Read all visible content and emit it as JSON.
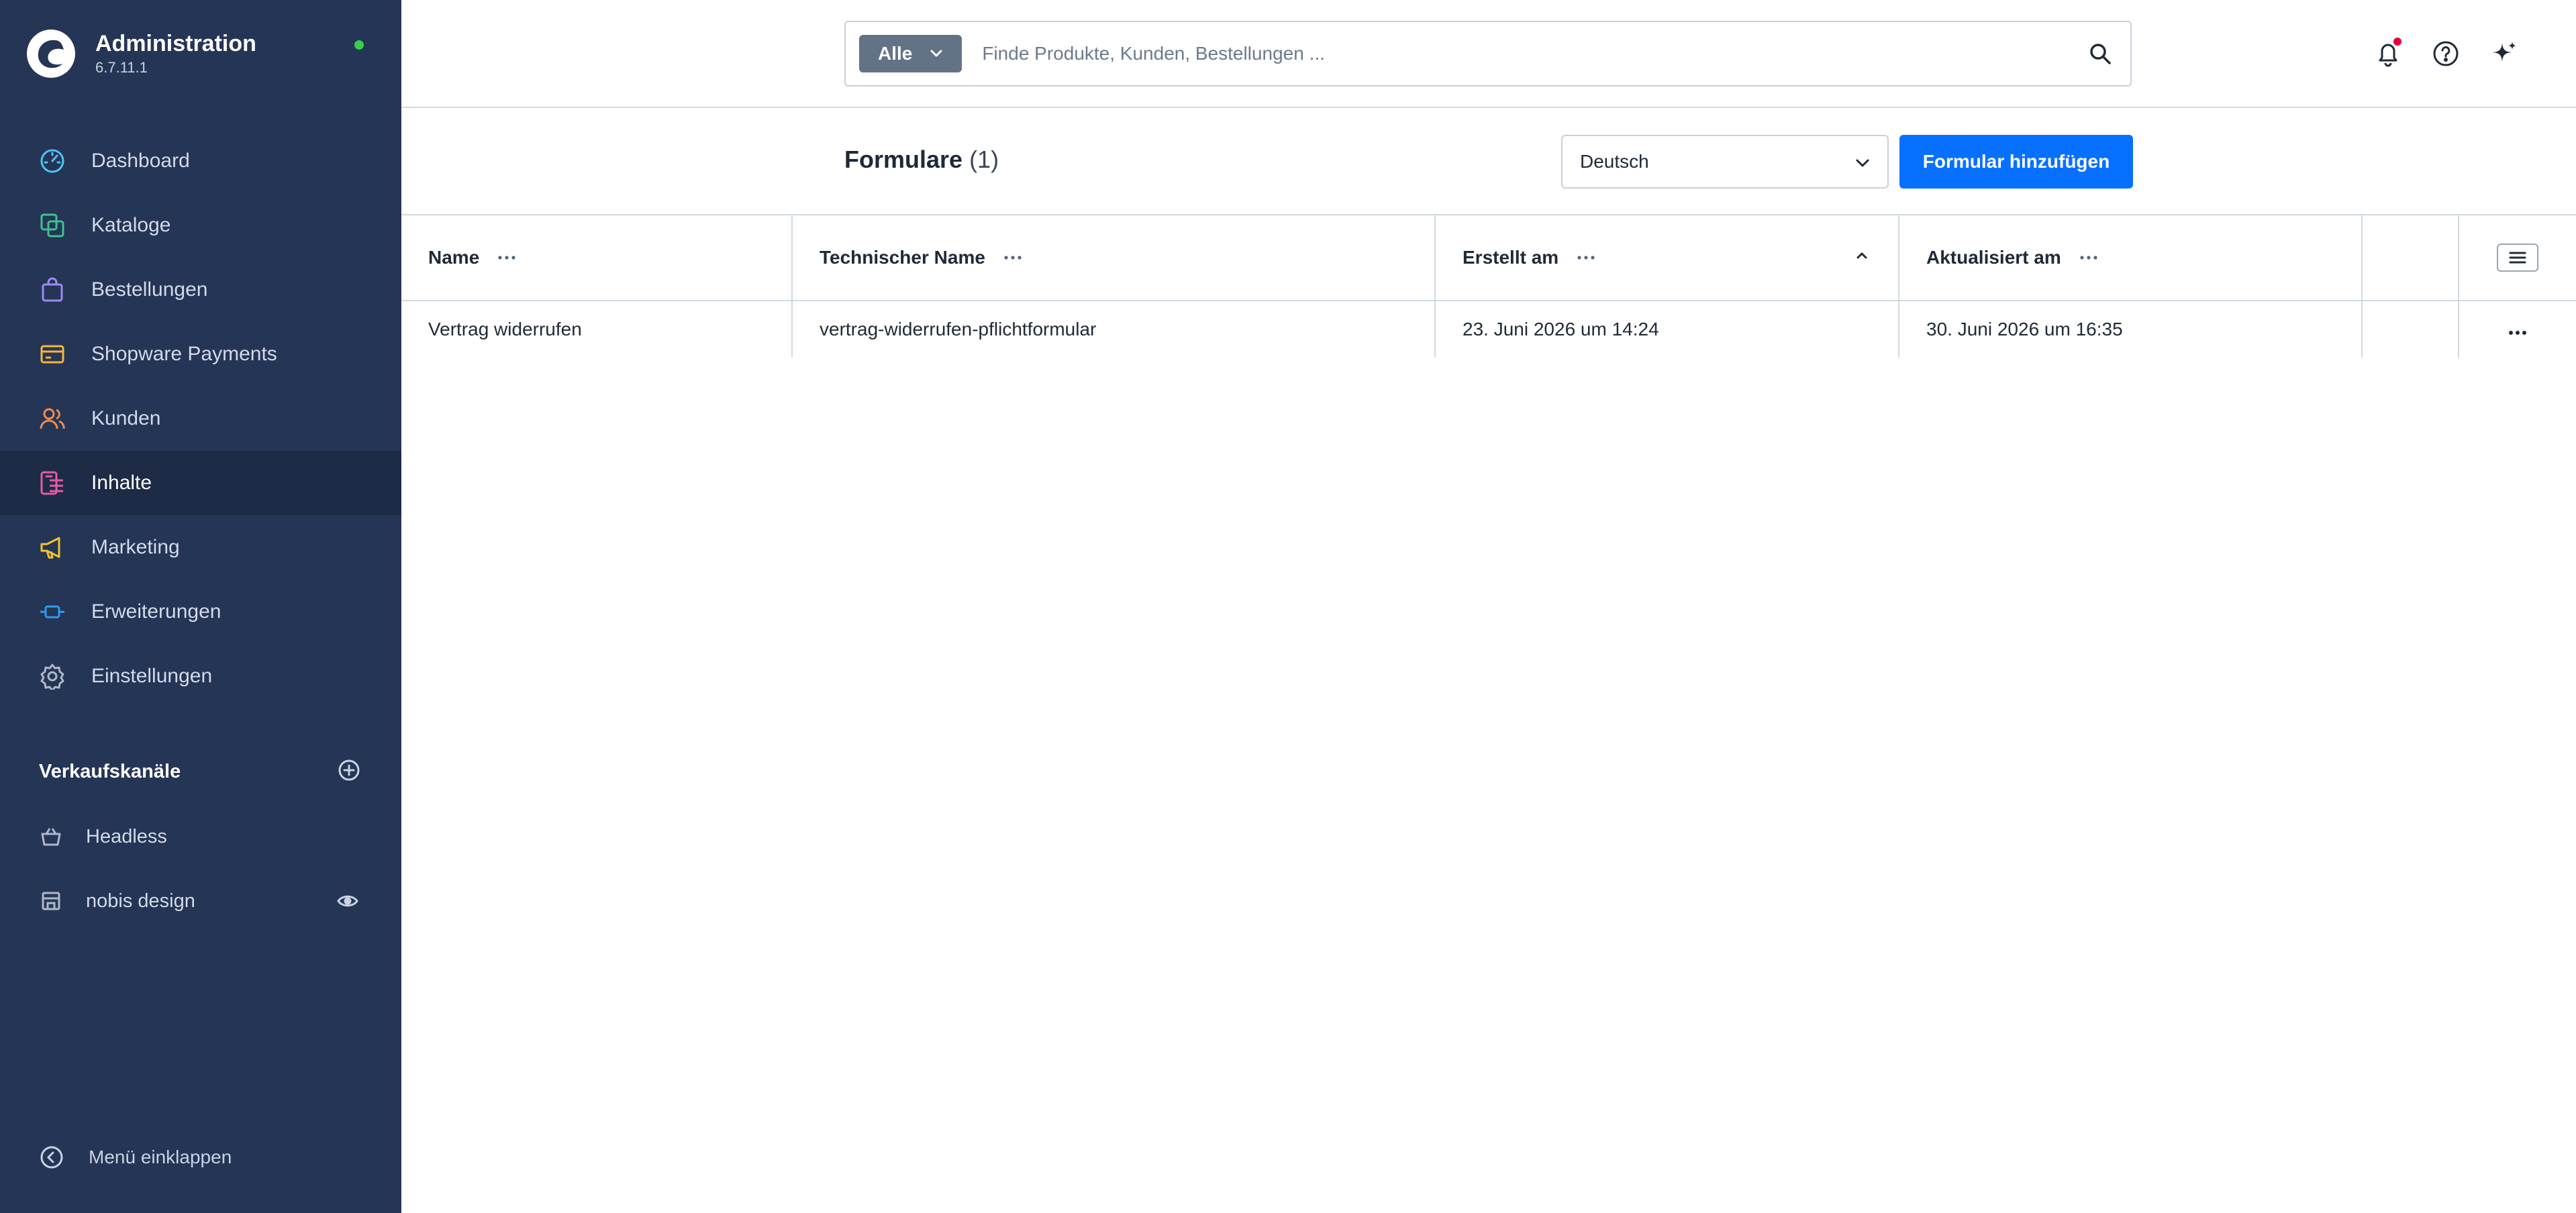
{
  "app": {
    "title": "Administration",
    "version": "6.7.11.1"
  },
  "colors": {
    "sidebar_bg": "#253556",
    "sidebar_active": "#1d2b46",
    "primary": "#0870ff",
    "status_online": "#37d046",
    "notification": "#e4003a"
  },
  "sidebar": {
    "items": [
      {
        "label": "Dashboard",
        "icon": "dashboard-icon",
        "color": "#4fc3f7"
      },
      {
        "label": "Kataloge",
        "icon": "catalog-icon",
        "color": "#3ec28f"
      },
      {
        "label": "Bestellungen",
        "icon": "shopping-bag-icon",
        "color": "#9b8cf5"
      },
      {
        "label": "Shopware Payments",
        "icon": "credit-card-icon",
        "color": "#f5b73b"
      },
      {
        "label": "Kunden",
        "icon": "users-icon",
        "color": "#f08c4f"
      },
      {
        "label": "Inhalte",
        "icon": "content-icon",
        "color": "#e45ba5",
        "active": true
      },
      {
        "label": "Marketing",
        "icon": "megaphone-icon",
        "color": "#f3c42b"
      },
      {
        "label": "Erweiterungen",
        "icon": "plug-icon",
        "color": "#2f9bf0"
      },
      {
        "label": "Einstellungen",
        "icon": "gear-icon",
        "color": "#aeb8c8"
      }
    ],
    "channels_title": "Verkaufskanäle",
    "channels": [
      {
        "label": "Headless",
        "icon": "basket-icon"
      },
      {
        "label": "nobis design",
        "icon": "storefront-icon"
      }
    ],
    "collapse_label": "Menü einklappen"
  },
  "search": {
    "filter_label": "Alle",
    "placeholder": "Finde Produkte, Kunden, Bestellungen ..."
  },
  "toolbar": {
    "title": "Formulare",
    "count": "(1)",
    "language": "Deutsch",
    "add_label": "Formular hinzufügen"
  },
  "grid": {
    "columns": [
      "Name",
      "Technischer Name",
      "Erstellt am",
      "Aktualisiert am"
    ],
    "rows": [
      [
        "Vertrag widerrufen",
        "vertrag-widerrufen-pflichtformular",
        "23. Juni 2026 um 14:24",
        "30. Juni 2026 um 16:35"
      ]
    ]
  }
}
